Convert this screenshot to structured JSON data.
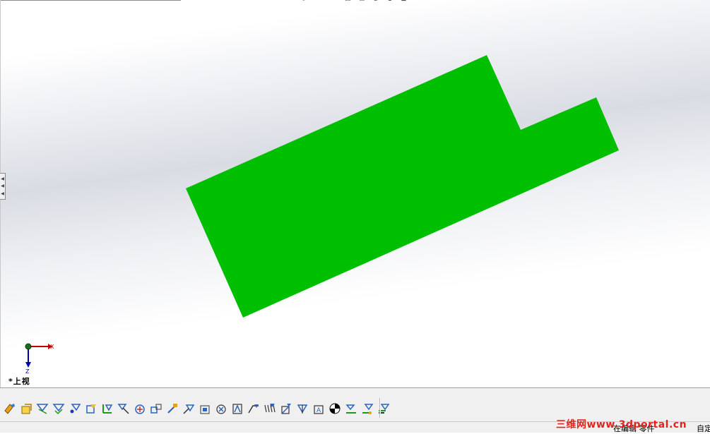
{
  "view": {
    "orientation_label": "*上视",
    "triad": {
      "x_label": "X",
      "z_label": "Z"
    },
    "model_color": "#00bf00",
    "background_top": "#ffffff",
    "background_band": "#d9dce3"
  },
  "heads_up_toolbar": {
    "icons": [
      "zoom-to-fit-icon",
      "zoom-area-icon",
      "previous-view-icon",
      "section-view-icon",
      "view-orientation-icon",
      "display-style-icon",
      "appearance-icon",
      "scene-icon"
    ]
  },
  "toolbar": {
    "icons": [
      "fillet-icon",
      "sketch-icon",
      "smart-dimension-icon",
      "reference-line-icon",
      "point-icon",
      "plane-icon",
      "coordinate-system-icon",
      "mate-reference-icon",
      "rotate-icon",
      "move-icon",
      "edit-icon",
      "reference-axis-icon",
      "feature-icon",
      "relations-icon",
      "extrude-icon",
      "cut-icon",
      "pattern-icon",
      "hatch-icon",
      "shell-icon",
      "surface-icon",
      "text-icon",
      "appearance-icon",
      "select-filter-icon",
      "sketch-filter-icon"
    ]
  },
  "statusbar": {
    "mode": "在编辑 零件",
    "unit": "自定"
  },
  "watermark": "三维网www.3dportal.cn"
}
